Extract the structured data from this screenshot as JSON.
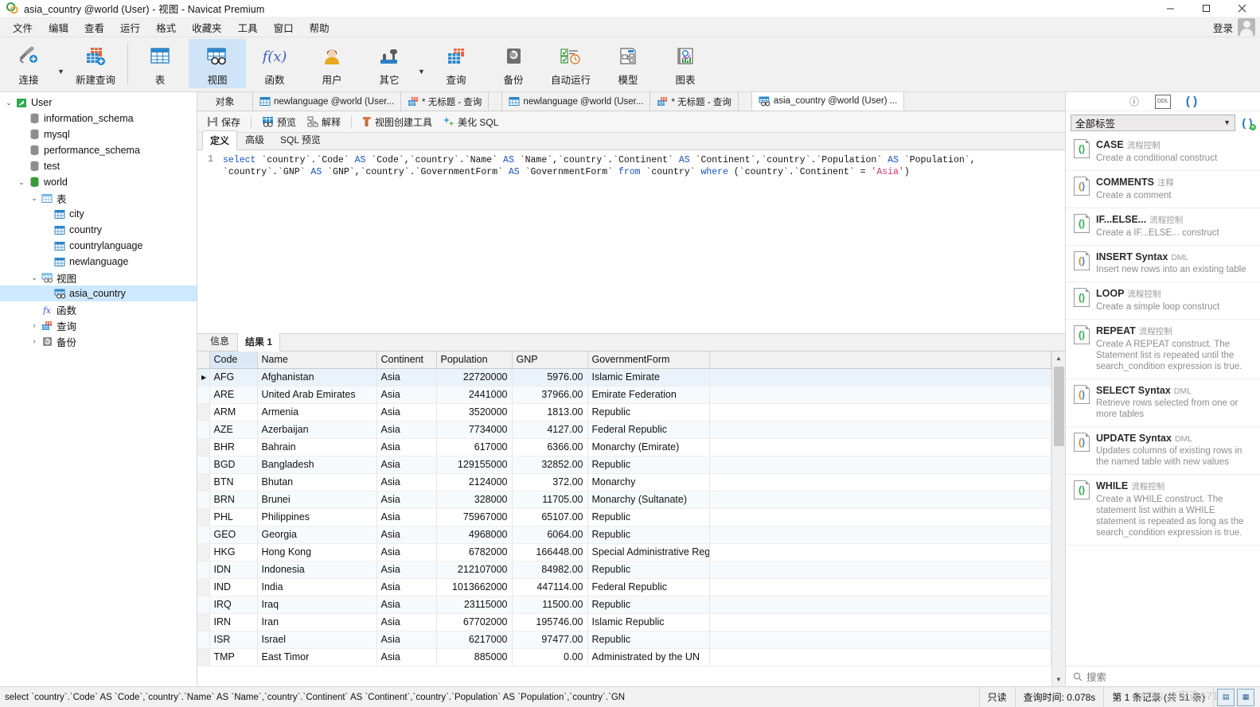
{
  "window": {
    "title": "asia_country @world (User) - 视图 - Navicat Premium",
    "minimize": "—",
    "maximize": "☐",
    "close": "✕"
  },
  "menubar": {
    "items": [
      {
        "label": "文件"
      },
      {
        "label": "编辑"
      },
      {
        "label": "查看"
      },
      {
        "label": "运行"
      },
      {
        "label": "格式"
      },
      {
        "label": "收藏夹"
      },
      {
        "label": "工具"
      },
      {
        "label": "窗口"
      },
      {
        "label": "帮助"
      }
    ],
    "login_label": "登录"
  },
  "ribbon": {
    "items": [
      {
        "label": "连接",
        "icon": "connection-icon",
        "has_caret": true
      },
      {
        "label": "新建查询",
        "icon": "new-query-icon",
        "has_caret": false
      },
      {
        "label": "表",
        "icon": "table-icon",
        "has_caret": false
      },
      {
        "label": "视图",
        "icon": "view-icon",
        "has_caret": false,
        "active": true
      },
      {
        "label": "函数",
        "icon": "function-icon",
        "has_caret": false
      },
      {
        "label": "用户",
        "icon": "user-icon",
        "has_caret": false
      },
      {
        "label": "其它",
        "icon": "other-tools-icon",
        "has_caret": true
      },
      {
        "label": "查询",
        "icon": "query-icon",
        "has_caret": false
      },
      {
        "label": "备份",
        "icon": "backup-icon",
        "has_caret": false
      },
      {
        "label": "自动运行",
        "icon": "automation-icon",
        "has_caret": false
      },
      {
        "label": "模型",
        "icon": "model-icon",
        "has_caret": false
      },
      {
        "label": "图表",
        "icon": "chart-icon",
        "has_caret": false
      }
    ]
  },
  "tree": {
    "nodes": [
      {
        "label": "User",
        "indent": 0,
        "expander": "v",
        "icon": "navicat-connection-icon",
        "selected": false
      },
      {
        "label": "information_schema",
        "indent": 1,
        "expander": "",
        "icon": "database-icon",
        "selected": false
      },
      {
        "label": "mysql",
        "indent": 1,
        "expander": "",
        "icon": "database-icon",
        "selected": false
      },
      {
        "label": "performance_schema",
        "indent": 1,
        "expander": "",
        "icon": "database-icon",
        "selected": false
      },
      {
        "label": "test",
        "indent": 1,
        "expander": "",
        "icon": "database-icon",
        "selected": false
      },
      {
        "label": "world",
        "indent": 1,
        "expander": "v",
        "icon": "database-active-icon",
        "selected": false
      },
      {
        "label": "表",
        "indent": 2,
        "expander": "v",
        "icon": "tables-folder-icon",
        "selected": false
      },
      {
        "label": "city",
        "indent": 3,
        "expander": "",
        "icon": "table-icon",
        "selected": false
      },
      {
        "label": "country",
        "indent": 3,
        "expander": "",
        "icon": "table-icon",
        "selected": false
      },
      {
        "label": "countrylanguage",
        "indent": 3,
        "expander": "",
        "icon": "table-icon",
        "selected": false
      },
      {
        "label": "newlanguage",
        "indent": 3,
        "expander": "",
        "icon": "table-icon",
        "selected": false
      },
      {
        "label": "视图",
        "indent": 2,
        "expander": "v",
        "icon": "views-folder-icon",
        "selected": false
      },
      {
        "label": "asia_country",
        "indent": 3,
        "expander": "",
        "icon": "view-icon",
        "selected": true
      },
      {
        "label": "函数",
        "indent": 2,
        "expander": "",
        "icon": "function-icon",
        "selected": false
      },
      {
        "label": "查询",
        "indent": 2,
        "expander": ">",
        "icon": "query-icon",
        "selected": false
      },
      {
        "label": "备份",
        "indent": 2,
        "expander": ">",
        "icon": "backup-icon",
        "selected": false
      }
    ]
  },
  "editor_tabs": {
    "object_label": "对象",
    "tabs": [
      {
        "label": "newlanguage @world (User...",
        "icon": "table-designer-icon",
        "active": false,
        "gap": false
      },
      {
        "label": "* 无标题 - 查询",
        "icon": "query-icon",
        "active": false,
        "gap": false
      },
      {
        "label": "newlanguage @world (User...",
        "icon": "table-icon",
        "active": false,
        "gap": true
      },
      {
        "label": "* 无标题 - 查询",
        "icon": "query-icon",
        "active": false,
        "gap": false
      },
      {
        "label": "asia_country @world (User) ...",
        "icon": "view-icon",
        "active": true,
        "gap": true
      }
    ]
  },
  "subtoolbar": {
    "buttons": [
      {
        "label": "保存",
        "icon": "save-icon"
      },
      {
        "label": "预览",
        "icon": "preview-icon"
      },
      {
        "label": "解释",
        "icon": "explain-icon"
      },
      {
        "label": "视图创建工具",
        "icon": "view-builder-icon"
      },
      {
        "label": "美化 SQL",
        "icon": "beautify-sql-icon"
      }
    ]
  },
  "mode_tabs": [
    {
      "label": "定义",
      "active": true
    },
    {
      "label": "高级",
      "active": false
    },
    {
      "label": "SQL 预览",
      "active": false
    }
  ],
  "sql": {
    "line_number": "1",
    "tokens": [
      {
        "t": "select ",
        "c": "kw"
      },
      {
        "t": "`country`.`Code` ",
        "c": "idq"
      },
      {
        "t": "AS ",
        "c": "kw"
      },
      {
        "t": "`Code`,`country`.`Name` ",
        "c": "idq"
      },
      {
        "t": "AS ",
        "c": "kw"
      },
      {
        "t": "`Name`,`country`.`Continent` ",
        "c": "idq"
      },
      {
        "t": "AS ",
        "c": "kw"
      },
      {
        "t": "`Continent`,`country`.`Population` ",
        "c": "idq"
      },
      {
        "t": "AS ",
        "c": "kw"
      },
      {
        "t": "`Population`,\n`country`.`GNP` ",
        "c": "idq"
      },
      {
        "t": "AS ",
        "c": "kw"
      },
      {
        "t": "`GNP`,`country`.`GovernmentForm` ",
        "c": "idq"
      },
      {
        "t": "AS ",
        "c": "kw"
      },
      {
        "t": "`GovernmentForm` ",
        "c": "idq"
      },
      {
        "t": "from ",
        "c": "kw"
      },
      {
        "t": "`country` ",
        "c": "idq"
      },
      {
        "t": "where ",
        "c": "kw"
      },
      {
        "t": "(`country`.`Continent` = ",
        "c": "idq"
      },
      {
        "t": "'Asia'",
        "c": "str"
      },
      {
        "t": ")",
        "c": "idq"
      }
    ]
  },
  "result_tabs": [
    {
      "label": "信息",
      "active": false
    },
    {
      "label": "结果 1",
      "active": true
    }
  ],
  "result_grid": {
    "columns": [
      "Code",
      "Name",
      "Continent",
      "Population",
      "GNP",
      "GovernmentForm"
    ],
    "rows": [
      {
        "Code": "AFG",
        "Name": "Afghanistan",
        "Continent": "Asia",
        "Population": "22720000",
        "GNP": "5976.00",
        "GovernmentForm": "Islamic Emirate"
      },
      {
        "Code": "ARE",
        "Name": "United Arab Emirates",
        "Continent": "Asia",
        "Population": "2441000",
        "GNP": "37966.00",
        "GovernmentForm": "Emirate Federation"
      },
      {
        "Code": "ARM",
        "Name": "Armenia",
        "Continent": "Asia",
        "Population": "3520000",
        "GNP": "1813.00",
        "GovernmentForm": "Republic"
      },
      {
        "Code": "AZE",
        "Name": "Azerbaijan",
        "Continent": "Asia",
        "Population": "7734000",
        "GNP": "4127.00",
        "GovernmentForm": "Federal Republic"
      },
      {
        "Code": "BHR",
        "Name": "Bahrain",
        "Continent": "Asia",
        "Population": "617000",
        "GNP": "6366.00",
        "GovernmentForm": "Monarchy (Emirate)"
      },
      {
        "Code": "BGD",
        "Name": "Bangladesh",
        "Continent": "Asia",
        "Population": "129155000",
        "GNP": "32852.00",
        "GovernmentForm": "Republic"
      },
      {
        "Code": "BTN",
        "Name": "Bhutan",
        "Continent": "Asia",
        "Population": "2124000",
        "GNP": "372.00",
        "GovernmentForm": "Monarchy"
      },
      {
        "Code": "BRN",
        "Name": "Brunei",
        "Continent": "Asia",
        "Population": "328000",
        "GNP": "11705.00",
        "GovernmentForm": "Monarchy (Sultanate)"
      },
      {
        "Code": "PHL",
        "Name": "Philippines",
        "Continent": "Asia",
        "Population": "75967000",
        "GNP": "65107.00",
        "GovernmentForm": "Republic"
      },
      {
        "Code": "GEO",
        "Name": "Georgia",
        "Continent": "Asia",
        "Population": "4968000",
        "GNP": "6064.00",
        "GovernmentForm": "Republic"
      },
      {
        "Code": "HKG",
        "Name": "Hong Kong",
        "Continent": "Asia",
        "Population": "6782000",
        "GNP": "166448.00",
        "GovernmentForm": "Special Administrative Reg"
      },
      {
        "Code": "IDN",
        "Name": "Indonesia",
        "Continent": "Asia",
        "Population": "212107000",
        "GNP": "84982.00",
        "GovernmentForm": "Republic"
      },
      {
        "Code": "IND",
        "Name": "India",
        "Continent": "Asia",
        "Population": "1013662000",
        "GNP": "447114.00",
        "GovernmentForm": "Federal Republic"
      },
      {
        "Code": "IRQ",
        "Name": "Iraq",
        "Continent": "Asia",
        "Population": "23115000",
        "GNP": "11500.00",
        "GovernmentForm": "Republic"
      },
      {
        "Code": "IRN",
        "Name": "Iran",
        "Continent": "Asia",
        "Population": "67702000",
        "GNP": "195746.00",
        "GovernmentForm": "Islamic Republic"
      },
      {
        "Code": "ISR",
        "Name": "Israel",
        "Continent": "Asia",
        "Population": "6217000",
        "GNP": "97477.00",
        "GovernmentForm": "Republic"
      },
      {
        "Code": "TMP",
        "Name": "East Timor",
        "Continent": "Asia",
        "Population": "885000",
        "GNP": "0.00",
        "GovernmentForm": "Administrated by the UN"
      }
    ]
  },
  "right_panel": {
    "icons": [
      {
        "name": "info-icon",
        "glyph": "ⓘ",
        "active": false
      },
      {
        "name": "ddl-icon",
        "glyph": "DDL",
        "active": false
      },
      {
        "name": "snippets-icon",
        "glyph": "( )",
        "active": true
      }
    ],
    "filter_value": "全部标签",
    "add_label": "+",
    "search_placeholder": "搜索",
    "snippets": [
      {
        "title": "CASE",
        "tag": "流程控制",
        "desc": "Create a conditional construct",
        "color": "green"
      },
      {
        "title": "COMMENTS",
        "tag": "注释",
        "desc": "Create a comment",
        "color": "orange"
      },
      {
        "title": "IF...ELSE...",
        "tag": "流程控制",
        "desc": "Create a IF...ELSE... construct",
        "color": "green"
      },
      {
        "title": "INSERT Syntax",
        "tag": "DML",
        "desc": "Insert new rows into an existing table",
        "color": "orange"
      },
      {
        "title": "LOOP",
        "tag": "流程控制",
        "desc": "Create a simple loop construct",
        "color": "green"
      },
      {
        "title": "REPEAT",
        "tag": "流程控制",
        "desc": "Create A REPEAT construct. The Statement list is repeated until the search_condition expression is true.",
        "color": "green"
      },
      {
        "title": "SELECT Syntax",
        "tag": "DML",
        "desc": "Retrieve rows selected from one or more tables",
        "color": "orange"
      },
      {
        "title": "UPDATE Syntax",
        "tag": "DML",
        "desc": "Updates columns of existing rows in the named table with new values",
        "color": "orange"
      },
      {
        "title": "WHILE",
        "tag": "流程控制",
        "desc": "Create a WHILE construct. The statement list within a WHILE statement is repeated as long as the search_condition expression is true.",
        "color": "green"
      }
    ]
  },
  "statusbar": {
    "sql_text": "select `country`.`Code` AS `Code`,`country`.`Name` AS `Name`,`country`.`Continent` AS `Continent`,`country`.`Population` AS `Population`,`country`.`GN",
    "readonly": "只读",
    "query_time": "查询时间: 0.078s",
    "record_info": "第 1 条记录 (共 51 条)",
    "watermark": "CSDN @安逸671"
  },
  "colors": {
    "accent": "#1a73c9",
    "selection": "#cde8ff",
    "ribbon_active": "#cfe4f7",
    "green": "#3fb950",
    "string": "#d6336c",
    "keyword": "#1752c9"
  }
}
